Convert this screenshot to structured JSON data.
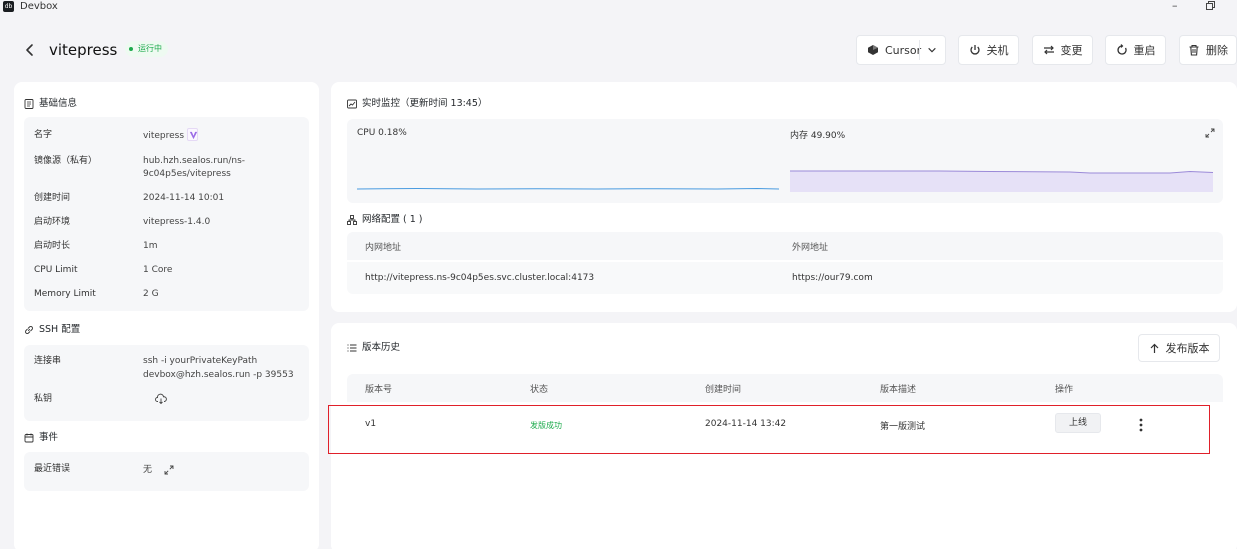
{
  "window": {
    "app_name": "Devbox",
    "minimize_glyph": "–"
  },
  "header": {
    "title": "vitepress",
    "status": "运行中",
    "buttons": {
      "ide": "Cursor",
      "shutdown": "关机",
      "change": "变更",
      "restart": "重启",
      "delete": "删除"
    }
  },
  "basic_info": {
    "title": "基础信息",
    "rows": [
      {
        "label": "名字",
        "value": "vitepress"
      },
      {
        "label": "镜像源（私有）",
        "value": "hub.hzh.sealos.run/ns-",
        "value2": "9c04p5es/vitepress"
      },
      {
        "label": "创建时间",
        "value": "2024-11-14 10:01"
      },
      {
        "label": "启动环境",
        "value": "vitepress-1.4.0"
      },
      {
        "label": "启动时长",
        "value": "1m"
      },
      {
        "label": "CPU Limit",
        "value": "1 Core"
      },
      {
        "label": "Memory Limit",
        "value": "2 G"
      }
    ]
  },
  "ssh": {
    "title": "SSH 配置",
    "connection_label": "连接串",
    "connection_line1": "ssh -i yourPrivateKeyPath",
    "connection_line2": "devbox@hzh.sealos.run -p 39553",
    "key_label": "私钥"
  },
  "events": {
    "title": "事件",
    "recent_error_label": "最近错误",
    "recent_error_value": "无"
  },
  "monitor": {
    "title": "实时监控（更新时间 13:45）",
    "cpu_label": "CPU 0.18%",
    "memory_label": "内存 49.90%",
    "cpu_color": "#4a9be0",
    "memory_color": "#9b8ad8"
  },
  "network": {
    "title": "网络配置 ( 1 )",
    "col_internal": "内网地址",
    "col_external": "外网地址",
    "internal": "http://vitepress.ns-9c04p5es.svc.cluster.local:4173",
    "external": "https://our79.com"
  },
  "versions": {
    "title": "版本历史",
    "publish_button": "发布版本",
    "columns": [
      "版本号",
      "状态",
      "创建时间",
      "版本描述",
      "操作"
    ],
    "rows": [
      {
        "version": "v1",
        "status": "发版成功",
        "created": "2024-11-14 13:42",
        "desc": "第一版测试",
        "action": "上线"
      }
    ],
    "success_color": "#1eab4d"
  }
}
